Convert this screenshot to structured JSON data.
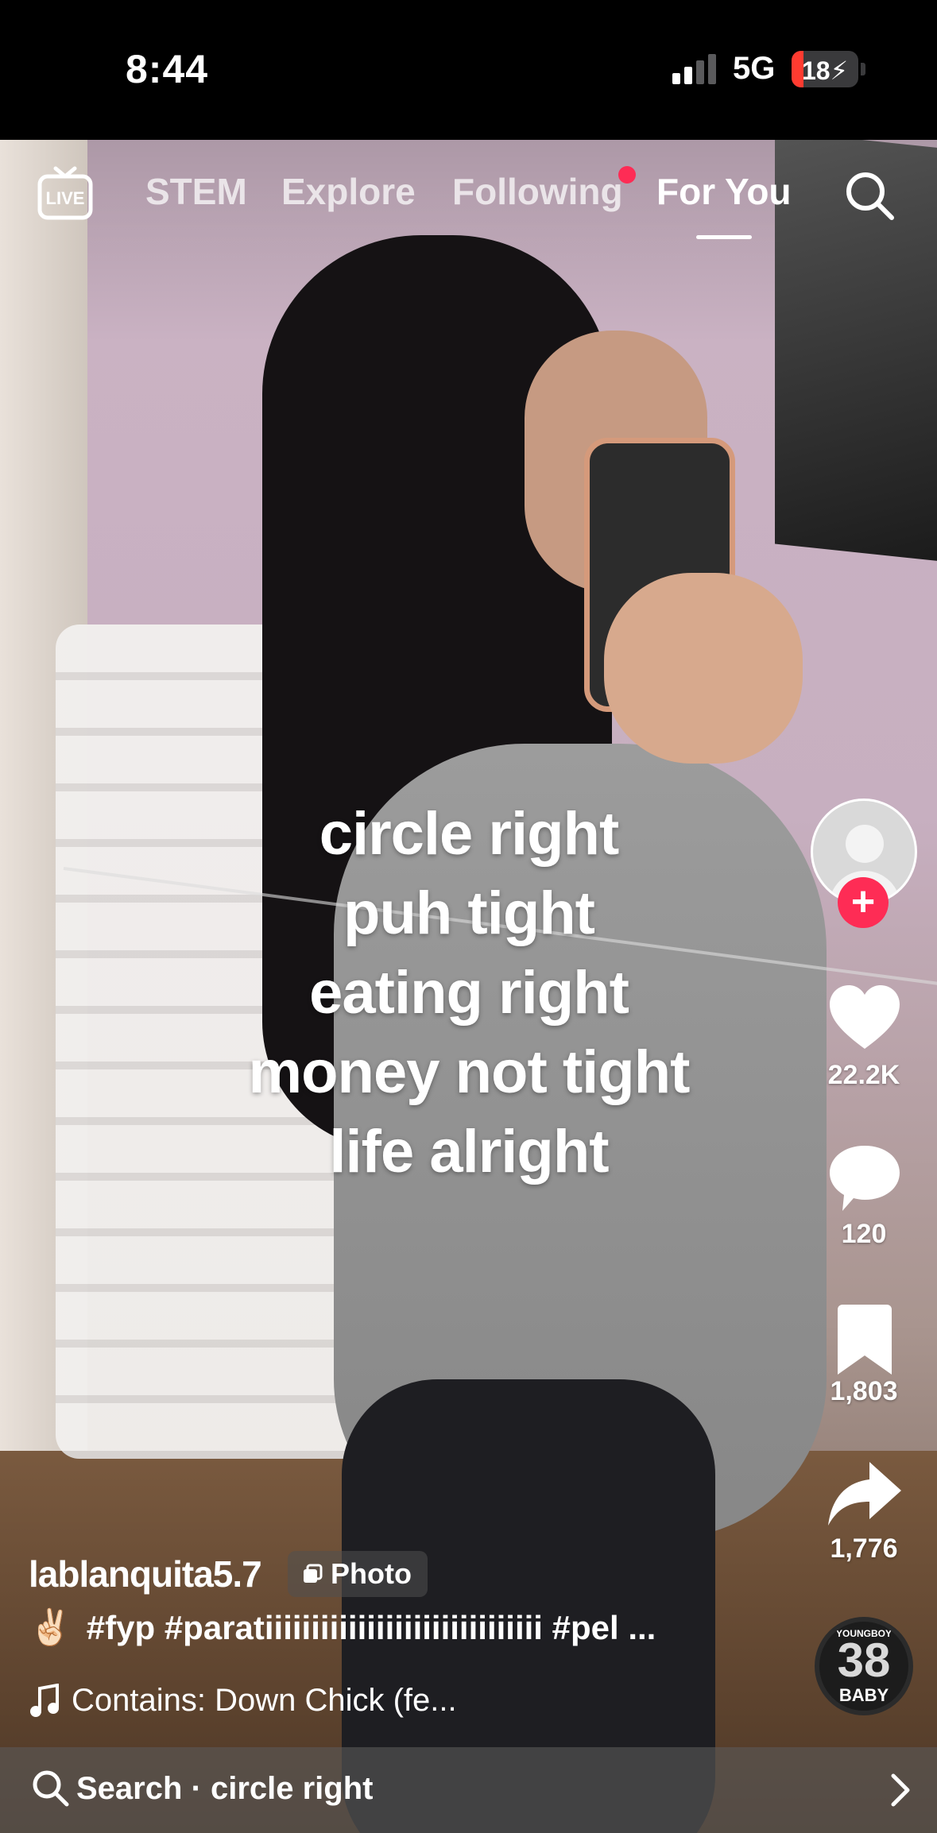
{
  "status_bar": {
    "time": "8:44",
    "network": "5G",
    "battery_level": "18",
    "battery_percent": 18,
    "battery_fill_color": "#ff3b30"
  },
  "top_nav": {
    "live_label": "LIVE",
    "tabs": [
      {
        "label": "STEM",
        "active": false
      },
      {
        "label": "Explore",
        "active": false
      },
      {
        "label": "Following",
        "active": false,
        "has_notification_dot": true
      },
      {
        "label": "For You",
        "active": true
      }
    ],
    "search_icon": "search-icon"
  },
  "caption": {
    "lines": [
      "circle right",
      "puh tight",
      "eating right",
      "money not tight",
      "life alright"
    ]
  },
  "rail": {
    "follow_icon": "plus-icon",
    "like_count": "22.2K",
    "comment_count": "120",
    "bookmark_count": "1,803",
    "share_count": "1,776",
    "accent_color": "#fe2c55"
  },
  "music_disc": {
    "top_text": "YOUNGBOY",
    "number": "38",
    "bottom_text": "BABY"
  },
  "post": {
    "username": "lablanquita5.7",
    "badge_label": "Photo",
    "emoji": "✌🏻",
    "description": "#fyp #paratiiiiiiiiiiiiiiiiiiiiiiiiiiiiii #pel ...",
    "music": "Contains: Down Chick (fe..."
  },
  "bottom_search": {
    "text": "Search · circle right"
  }
}
